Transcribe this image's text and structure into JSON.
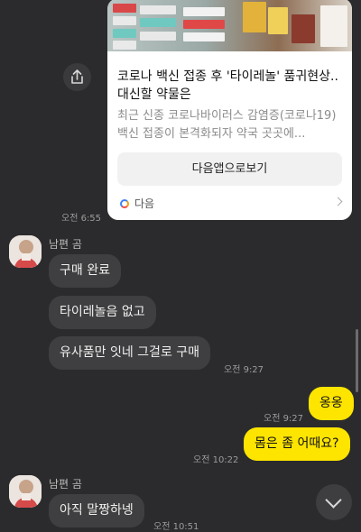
{
  "link_card": {
    "title": "코로나 백신 접종 후 '타이레놀' 품귀현상.. 대신할 약물은",
    "description": "최근 신종 코로나바이러스 감염증(코로나19) 백신 접종이 본격화되자 약국 곳곳에...",
    "open_app_label": "다음앱으로보기",
    "source": "다음",
    "time": "오전 6:55"
  },
  "messages": [
    {
      "sender": "남편 곰",
      "bubbles": [
        "구매 완료",
        "타이레놀음 없고",
        "유사품만 잇네 그걸로 구매"
      ],
      "time": "오전 9:27"
    },
    {
      "mine": true,
      "bubbles": [
        "옹옹"
      ],
      "time": "오전 9:27"
    },
    {
      "mine": true,
      "bubbles": [
        "몸은 좀 어때요?"
      ],
      "time": "오전 10:22"
    },
    {
      "sender": "남편 곰",
      "bubbles": [
        "아직 말짱하넹"
      ],
      "time": "오전 10:51"
    }
  ],
  "colors": {
    "background": "#2b2b2d",
    "my_bubble": "#fee500",
    "their_bubble": "#3f3f41"
  },
  "icons": {
    "share": "share-icon",
    "scroll_down": "chevron-down-icon"
  }
}
